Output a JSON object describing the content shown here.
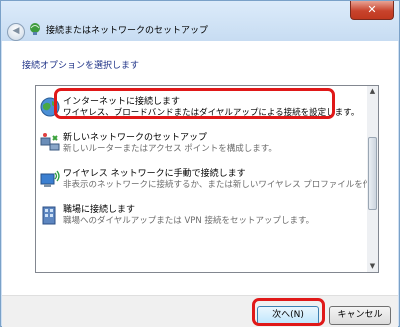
{
  "window": {
    "title": "接続またはネットワークのセットアップ",
    "close_glyph": "✕",
    "back_glyph": "◀"
  },
  "heading": "接続オプションを選択します",
  "options": [
    {
      "title": "インターネットに接続します",
      "desc": "ワイヤレス、ブロードバンドまたはダイヤルアップによる接続を設定します。",
      "icon": "globe-network-icon"
    },
    {
      "title": "新しいネットワークのセットアップ",
      "desc": "新しいルーターまたはアクセス ポイントを構成します。",
      "icon": "router-network-icon"
    },
    {
      "title": "ワイヤレス ネットワークに手動で接続します",
      "desc": "非表示のネットワークに接続するか、または新しいワイヤレス プロファイルを作成...",
      "icon": "wireless-computer-icon"
    },
    {
      "title": "職場に接続します",
      "desc": "職場へのダイヤルアップまたは VPN 接続をセットアップします。",
      "icon": "workplace-building-icon"
    }
  ],
  "buttons": {
    "next": "次へ(N)",
    "cancel": "キャンセル"
  },
  "scroll": {
    "up": "▲",
    "down": "▼"
  },
  "colors": {
    "heading": "#1e3287",
    "highlight": "#e01818",
    "window_frame": "#cfe0f3"
  }
}
